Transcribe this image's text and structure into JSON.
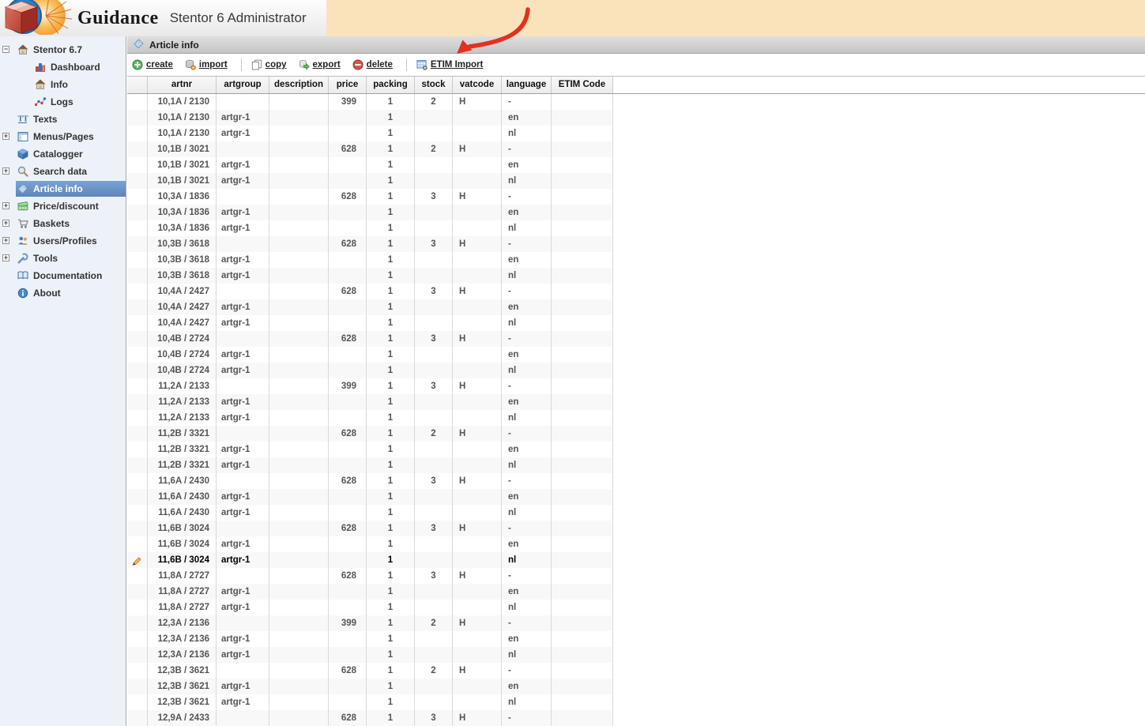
{
  "header": {
    "brand": "Guidance",
    "subtitle": "Stentor 6 Administrator",
    "logo": "guidance-cube-logo",
    "beige_color": "#fae3ba"
  },
  "annotation": {
    "shape": "curved-arrow",
    "color": "#e2311d",
    "points_at": "ETIM Import"
  },
  "sidebar": {
    "selected_color": "#5c86ba",
    "items": [
      {
        "label": "Stentor 6.7",
        "icon": "home-icon",
        "level": 0,
        "expander": "minus",
        "selected": false
      },
      {
        "label": "Dashboard",
        "icon": "dashboard-chart-icon",
        "level": 1,
        "expander": null,
        "selected": false
      },
      {
        "label": "Info",
        "icon": "home-icon",
        "level": 1,
        "expander": null,
        "selected": false
      },
      {
        "label": "Logs",
        "icon": "logs-graph-icon",
        "level": 1,
        "expander": null,
        "selected": false
      },
      {
        "label": "Texts",
        "icon": "texts-icon",
        "level": 0,
        "expander": null,
        "selected": false
      },
      {
        "label": "Menus/Pages",
        "icon": "menus-pages-icon",
        "level": 0,
        "expander": "plus",
        "selected": false
      },
      {
        "label": "Catalogger",
        "icon": "catalogger-icon",
        "level": 0,
        "expander": null,
        "selected": false
      },
      {
        "label": "Search data",
        "icon": "search-icon",
        "level": 0,
        "expander": "plus",
        "selected": false
      },
      {
        "label": "Article info",
        "icon": "tag-icon",
        "level": 0,
        "expander": null,
        "selected": true
      },
      {
        "label": "Price/discount",
        "icon": "money-icon",
        "level": 0,
        "expander": "plus",
        "selected": false
      },
      {
        "label": "Baskets",
        "icon": "basket-icon",
        "level": 0,
        "expander": "plus",
        "selected": false
      },
      {
        "label": "Users/Profiles",
        "icon": "users-icon",
        "level": 0,
        "expander": "plus",
        "selected": false
      },
      {
        "label": "Tools",
        "icon": "tools-icon",
        "level": 0,
        "expander": "plus",
        "selected": false
      },
      {
        "label": "Documentation",
        "icon": "documentation-icon",
        "level": 0,
        "expander": null,
        "selected": false
      },
      {
        "label": "About",
        "icon": "about-icon",
        "level": 0,
        "expander": null,
        "selected": false
      }
    ]
  },
  "panel": {
    "title": "Article info",
    "icon": "tag-icon"
  },
  "toolbar": {
    "buttons": [
      {
        "type": "button",
        "label": "create",
        "icon": "create-plus-icon"
      },
      {
        "type": "button",
        "label": "import",
        "icon": "import-db-icon"
      },
      {
        "type": "separator"
      },
      {
        "type": "button",
        "label": "copy",
        "icon": "copy-icon"
      },
      {
        "type": "button",
        "label": "export",
        "icon": "export-db-icon"
      },
      {
        "type": "button",
        "label": "delete",
        "icon": "delete-minus-icon"
      },
      {
        "type": "separator"
      },
      {
        "type": "button",
        "label": "ETIM Import",
        "icon": "etim-import-icon"
      }
    ]
  },
  "table": {
    "columns": [
      "artnr",
      "artgroup",
      "description",
      "price",
      "packing",
      "stock",
      "vatcode",
      "language",
      "ETIM Code"
    ],
    "highlighted_row": {
      "index": 29,
      "marker": "pencil-icon"
    },
    "rows": [
      [
        "10,1A / 2130",
        "",
        "",
        "399",
        "1",
        "2",
        "H",
        "-",
        ""
      ],
      [
        "10,1A / 2130",
        "artgr-1",
        "",
        "",
        "1",
        "",
        "",
        "en",
        ""
      ],
      [
        "10,1A / 2130",
        "artgr-1",
        "",
        "",
        "1",
        "",
        "",
        "nl",
        ""
      ],
      [
        "10,1B / 3021",
        "",
        "",
        "628",
        "1",
        "2",
        "H",
        "-",
        ""
      ],
      [
        "10,1B / 3021",
        "artgr-1",
        "",
        "",
        "1",
        "",
        "",
        "en",
        ""
      ],
      [
        "10,1B / 3021",
        "artgr-1",
        "",
        "",
        "1",
        "",
        "",
        "nl",
        ""
      ],
      [
        "10,3A / 1836",
        "",
        "",
        "628",
        "1",
        "3",
        "H",
        "-",
        ""
      ],
      [
        "10,3A / 1836",
        "artgr-1",
        "",
        "",
        "1",
        "",
        "",
        "en",
        ""
      ],
      [
        "10,3A / 1836",
        "artgr-1",
        "",
        "",
        "1",
        "",
        "",
        "nl",
        ""
      ],
      [
        "10,3B / 3618",
        "",
        "",
        "628",
        "1",
        "3",
        "H",
        "-",
        ""
      ],
      [
        "10,3B / 3618",
        "artgr-1",
        "",
        "",
        "1",
        "",
        "",
        "en",
        ""
      ],
      [
        "10,3B / 3618",
        "artgr-1",
        "",
        "",
        "1",
        "",
        "",
        "nl",
        ""
      ],
      [
        "10,4A / 2427",
        "",
        "",
        "628",
        "1",
        "3",
        "H",
        "-",
        ""
      ],
      [
        "10,4A / 2427",
        "artgr-1",
        "",
        "",
        "1",
        "",
        "",
        "en",
        ""
      ],
      [
        "10,4A / 2427",
        "artgr-1",
        "",
        "",
        "1",
        "",
        "",
        "nl",
        ""
      ],
      [
        "10,4B / 2724",
        "",
        "",
        "628",
        "1",
        "3",
        "H",
        "-",
        ""
      ],
      [
        "10,4B / 2724",
        "artgr-1",
        "",
        "",
        "1",
        "",
        "",
        "en",
        ""
      ],
      [
        "10,4B / 2724",
        "artgr-1",
        "",
        "",
        "1",
        "",
        "",
        "nl",
        ""
      ],
      [
        "11,2A / 2133",
        "",
        "",
        "399",
        "1",
        "3",
        "H",
        "-",
        ""
      ],
      [
        "11,2A / 2133",
        "artgr-1",
        "",
        "",
        "1",
        "",
        "",
        "en",
        ""
      ],
      [
        "11,2A / 2133",
        "artgr-1",
        "",
        "",
        "1",
        "",
        "",
        "nl",
        ""
      ],
      [
        "11,2B / 3321",
        "",
        "",
        "628",
        "1",
        "2",
        "H",
        "-",
        ""
      ],
      [
        "11,2B / 3321",
        "artgr-1",
        "",
        "",
        "1",
        "",
        "",
        "en",
        ""
      ],
      [
        "11,2B / 3321",
        "artgr-1",
        "",
        "",
        "1",
        "",
        "",
        "nl",
        ""
      ],
      [
        "11,6A / 2430",
        "",
        "",
        "628",
        "1",
        "3",
        "H",
        "-",
        ""
      ],
      [
        "11,6A / 2430",
        "artgr-1",
        "",
        "",
        "1",
        "",
        "",
        "en",
        ""
      ],
      [
        "11,6A / 2430",
        "artgr-1",
        "",
        "",
        "1",
        "",
        "",
        "nl",
        ""
      ],
      [
        "11,6B / 3024",
        "",
        "",
        "628",
        "1",
        "3",
        "H",
        "-",
        ""
      ],
      [
        "11,6B / 3024",
        "artgr-1",
        "",
        "",
        "1",
        "",
        "",
        "en",
        ""
      ],
      [
        "11,6B / 3024",
        "artgr-1",
        "",
        "",
        "1",
        "",
        "",
        "nl",
        ""
      ],
      [
        "11,8A / 2727",
        "",
        "",
        "628",
        "1",
        "3",
        "H",
        "-",
        ""
      ],
      [
        "11,8A / 2727",
        "artgr-1",
        "",
        "",
        "1",
        "",
        "",
        "en",
        ""
      ],
      [
        "11,8A / 2727",
        "artgr-1",
        "",
        "",
        "1",
        "",
        "",
        "nl",
        ""
      ],
      [
        "12,3A / 2136",
        "",
        "",
        "399",
        "1",
        "2",
        "H",
        "-",
        ""
      ],
      [
        "12,3A / 2136",
        "artgr-1",
        "",
        "",
        "1",
        "",
        "",
        "en",
        ""
      ],
      [
        "12,3A / 2136",
        "artgr-1",
        "",
        "",
        "1",
        "",
        "",
        "nl",
        ""
      ],
      [
        "12,3B / 3621",
        "",
        "",
        "628",
        "1",
        "2",
        "H",
        "-",
        ""
      ],
      [
        "12,3B / 3621",
        "artgr-1",
        "",
        "",
        "1",
        "",
        "",
        "en",
        ""
      ],
      [
        "12,3B / 3621",
        "artgr-1",
        "",
        "",
        "1",
        "",
        "",
        "nl",
        ""
      ],
      [
        "12,9A / 2433",
        "",
        "",
        "628",
        "1",
        "3",
        "H",
        "-",
        ""
      ]
    ]
  }
}
